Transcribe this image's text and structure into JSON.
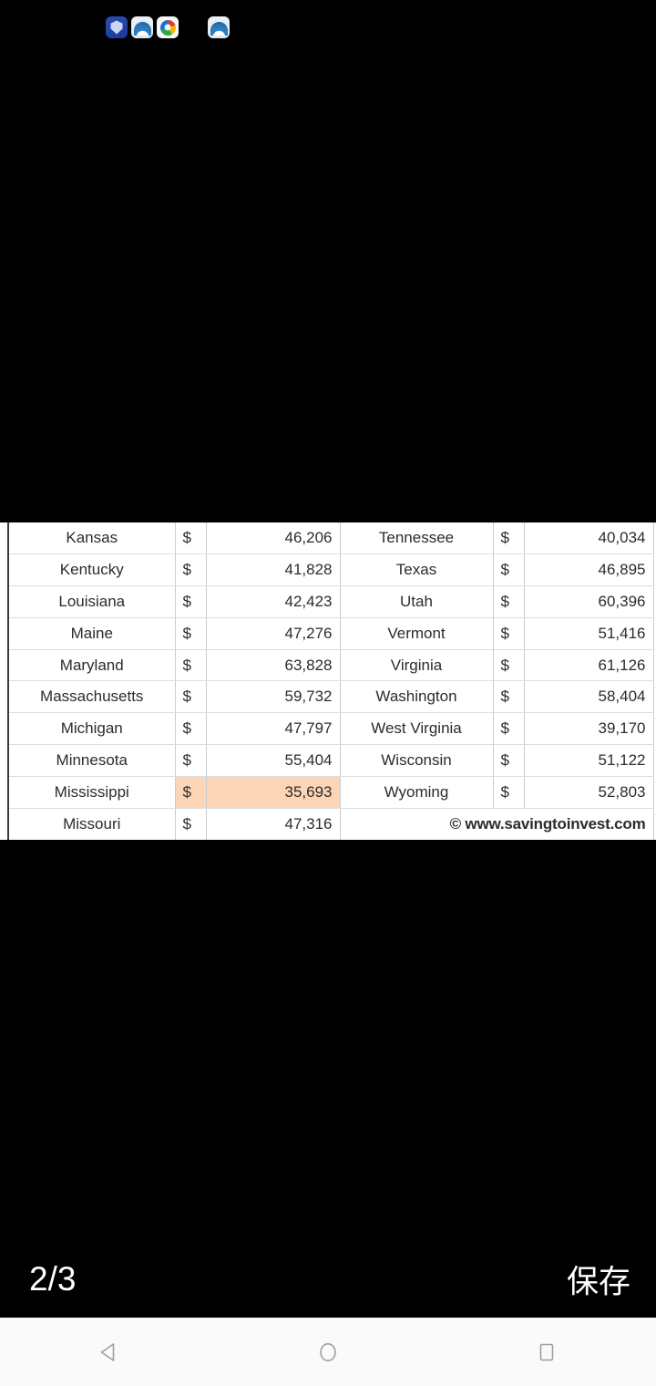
{
  "status_bar": {
    "notification_icons": [
      {
        "name": "shield-icon",
        "style": "shield"
      },
      {
        "name": "arch-app-icon",
        "style": "arch"
      },
      {
        "name": "color-wheel-icon",
        "style": "color"
      },
      {
        "name": "arch-app-icon-2",
        "style": "arch"
      }
    ]
  },
  "table": {
    "highlighted_row_state": "Mississippi",
    "currency_symbol": "$",
    "footer": "© www.savingtoinvest.com",
    "rows": [
      {
        "state_left": "Kansas",
        "symbol_left": "$",
        "value_left": "46,206",
        "state_right": "Tennessee",
        "symbol_right": "$",
        "value_right": "40,034"
      },
      {
        "state_left": "Kentucky",
        "symbol_left": "$",
        "value_left": "41,828",
        "state_right": "Texas",
        "symbol_right": "$",
        "value_right": "46,895"
      },
      {
        "state_left": "Louisiana",
        "symbol_left": "$",
        "value_left": "42,423",
        "state_right": "Utah",
        "symbol_right": "$",
        "value_right": "60,396"
      },
      {
        "state_left": "Maine",
        "symbol_left": "$",
        "value_left": "47,276",
        "state_right": "Vermont",
        "symbol_right": "$",
        "value_right": "51,416"
      },
      {
        "state_left": "Maryland",
        "symbol_left": "$",
        "value_left": "63,828",
        "state_right": "Virginia",
        "symbol_right": "$",
        "value_right": "61,126"
      },
      {
        "state_left": "Massachusetts",
        "symbol_left": "$",
        "value_left": "59,732",
        "state_right": "Washington",
        "symbol_right": "$",
        "value_right": "58,404"
      },
      {
        "state_left": "Michigan",
        "symbol_left": "$",
        "value_left": "47,797",
        "state_right": "West Virginia",
        "symbol_right": "$",
        "value_right": "39,170"
      },
      {
        "state_left": "Minnesota",
        "symbol_left": "$",
        "value_left": "55,404",
        "state_right": "Wisconsin",
        "symbol_right": "$",
        "value_right": "51,122"
      },
      {
        "state_left": "Mississippi",
        "symbol_left": "$",
        "value_left": "35,693",
        "state_right": "Wyoming",
        "symbol_right": "$",
        "value_right": "52,803"
      },
      {
        "state_left": "Missouri",
        "symbol_left": "$",
        "value_left": "47,316",
        "state_right": "",
        "symbol_right": "",
        "value_right": ""
      }
    ]
  },
  "bottom_bar": {
    "page_indicator": "2/3",
    "save_label": "保存"
  },
  "nav_bar": {
    "back_icon": "back-triangle-icon",
    "home_icon": "home-circle-icon",
    "recents_icon": "recents-square-icon"
  },
  "colors": {
    "highlight": "#FBD5B5",
    "background": "#000000",
    "table_background": "#FFFFFF",
    "nav_background": "#FAFAFA"
  }
}
